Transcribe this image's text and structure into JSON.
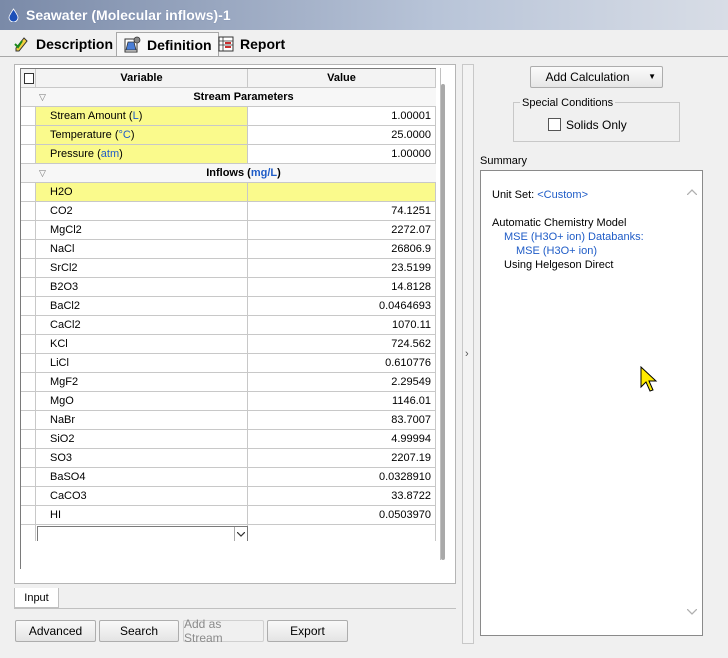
{
  "window": {
    "title": "Seawater (Molecular inflows)-1"
  },
  "tabs": [
    {
      "label": "Description",
      "icon": "pencil-check-icon"
    },
    {
      "label": "Definition",
      "icon": "flask-gear-icon"
    },
    {
      "label": "Report",
      "icon": "report-grid-icon"
    }
  ],
  "grid": {
    "headers": {
      "variable": "Variable",
      "value": "Value"
    },
    "stream_parameters": {
      "title": "Stream Parameters",
      "rows": [
        {
          "name": "Stream Amount",
          "unit": "L",
          "value": "1.00001"
        },
        {
          "name": "Temperature",
          "unit": "°C",
          "value": "25.0000"
        },
        {
          "name": "Pressure",
          "unit": "atm",
          "value": "1.00000"
        }
      ]
    },
    "inflows": {
      "title": "Inflows",
      "unit": "mg/L",
      "rows": [
        {
          "name": "H2O",
          "value": ""
        },
        {
          "name": "CO2",
          "value": "74.1251"
        },
        {
          "name": "MgCl2",
          "value": "2272.07"
        },
        {
          "name": "NaCl",
          "value": "26806.9"
        },
        {
          "name": "SrCl2",
          "value": "23.5199"
        },
        {
          "name": "B2O3",
          "value": "14.8128"
        },
        {
          "name": "BaCl2",
          "value": "0.0464693"
        },
        {
          "name": "CaCl2",
          "value": "1070.11"
        },
        {
          "name": "KCl",
          "value": "724.562"
        },
        {
          "name": "LiCl",
          "value": "0.610776"
        },
        {
          "name": "MgF2",
          "value": "2.29549"
        },
        {
          "name": "MgO",
          "value": "1146.01"
        },
        {
          "name": "NaBr",
          "value": "83.7007"
        },
        {
          "name": "SiO2",
          "value": "4.99994"
        },
        {
          "name": "SO3",
          "value": "2207.19"
        },
        {
          "name": "BaSO4",
          "value": "0.0328910"
        },
        {
          "name": "CaCO3",
          "value": "33.8722"
        },
        {
          "name": "HI",
          "value": "0.0503970"
        }
      ]
    }
  },
  "input_tab": "Input",
  "buttons": {
    "advanced": "Advanced",
    "search": "Search",
    "add_as_stream": "Add as Stream",
    "export": "Export"
  },
  "right": {
    "add_calculation": "Add Calculation",
    "special_conditions": "Special Conditions",
    "solids_only": "Solids Only",
    "summary_label": "Summary",
    "summary": {
      "unit_set_label": "Unit Set:",
      "unit_set_value": "<Custom>",
      "model": "Automatic Chemistry Model",
      "databanks": "MSE (H3O+ ion) Databanks:",
      "databank_item": "MSE (H3O+ ion)",
      "helgeson": "Using Helgeson Direct"
    }
  },
  "colors": {
    "highlight_yellow": "#fafa8c",
    "unit_blue": "#1f5cc7"
  }
}
